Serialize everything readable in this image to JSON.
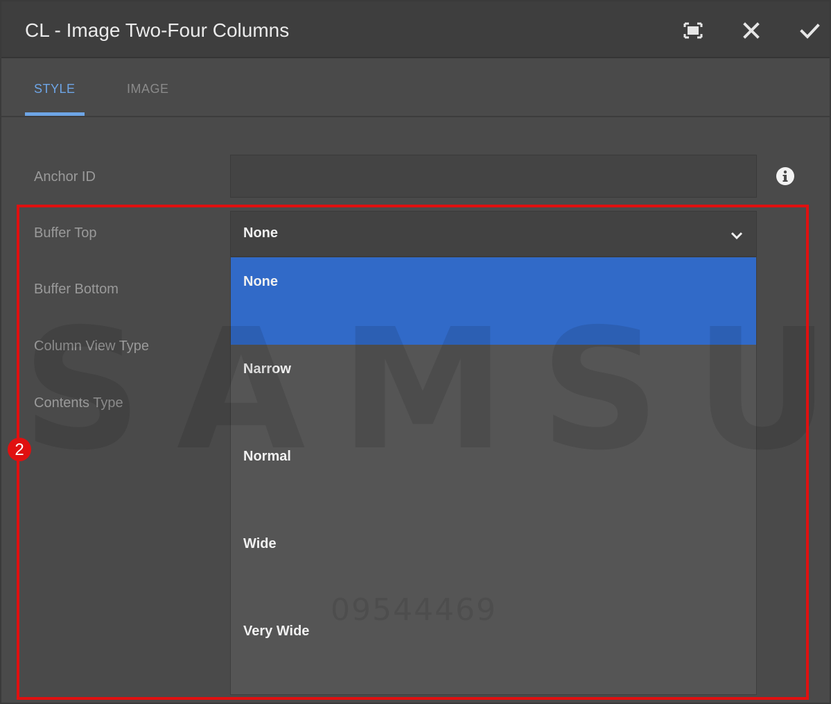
{
  "dialog": {
    "title": "CL - Image Two-Four Columns",
    "buttons": {
      "fullscreen_icon": "fullscreen-icon",
      "close_icon": "close-icon",
      "confirm_icon": "check-icon"
    }
  },
  "tabs": [
    {
      "label": "STYLE",
      "active": true
    },
    {
      "label": "IMAGE",
      "active": false
    }
  ],
  "form": {
    "anchor_id": {
      "label": "Anchor ID",
      "value": ""
    },
    "buffer_top": {
      "label": "Buffer Top",
      "value": "None"
    },
    "buffer_bottom": {
      "label": "Buffer Bottom"
    },
    "column_view_type": {
      "label": "Column View Type"
    },
    "contents_type": {
      "label": "Contents Type"
    }
  },
  "dropdown": {
    "options": [
      "None",
      "Narrow",
      "Normal",
      "Wide",
      "Very Wide"
    ],
    "selected": "None"
  },
  "annotation": {
    "badge": "2"
  },
  "watermark": {
    "brand": "SAMSUNG",
    "number": "09544469"
  },
  "colors": {
    "accent": "#6ea5e6",
    "selected_option": "#316ac8",
    "annotation": "#e01010"
  }
}
